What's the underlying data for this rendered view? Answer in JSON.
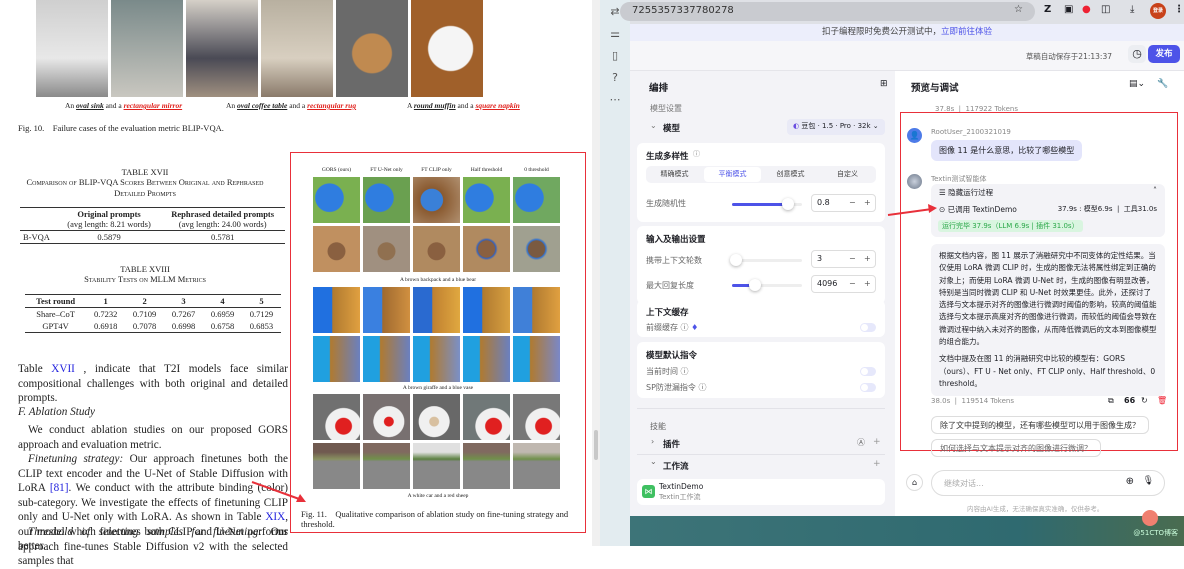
{
  "pdf": {
    "fig10_captions": [
      {
        "pre": "An ",
        "a": "oval sink",
        "mid": " and a ",
        "b": "rectangular mirror"
      },
      {
        "pre": "An ",
        "a": "oval coffee table",
        "mid": " and a ",
        "b": "rectangular rug"
      },
      {
        "pre": "A ",
        "a": "round muffin",
        "mid": " and a ",
        "b": "square napkin"
      }
    ],
    "fig10_caption": "Fig. 10.    Failure cases of the evaluation metric BLIP-VQA.",
    "table17": {
      "title": "TABLE XVII",
      "subtitle": "Comparison of BLIP-VQA Scores Between Original and Rephrased Detailed Prompts",
      "col1": "Original prompts",
      "col1_sub": "(avg length: 8.21 words)",
      "col2": "Rephrased detailed prompts",
      "col2_sub": "(avg length: 24.00 words)",
      "row_label": "B-VQA",
      "v1": "0.5879",
      "v2": "0.5781"
    },
    "table18": {
      "title": "TABLE XVIII",
      "subtitle": "Stability Tests on MLLM Metrics",
      "headers": [
        "Test round",
        "1",
        "2",
        "3",
        "4",
        "5"
      ],
      "rows": [
        [
          "Share–CoT",
          "0.7232",
          "0.7109",
          "0.7267",
          "0.6959",
          "0.7129"
        ],
        [
          "GPT4V",
          "0.6918",
          "0.7078",
          "0.6998",
          "0.6758",
          "0.6853"
        ]
      ]
    },
    "para1_pre": "Table ",
    "para1_link": "XVII",
    "para1_post": " , indicate that T2I models face similar compositional challenges with both original and detailed prompts.",
    "section": "F.  Ablation Study",
    "para2": "We conduct ablation studies on our proposed GORS approach and evaluation metric.",
    "para3_title": "Finetuning strategy:",
    "para3_a": " Our approach finetunes both the CLIP text encoder and the U-Net of Stable Diffusion with LoRA ",
    "para3_ref": "[81]",
    "para3_b": ". We conduct with the attribute binding (color) sub-category. We investigate the effects of finetuning CLIP only and U-Net only with LoRA. As shown in Table ",
    "para3_ref2": "XIX",
    "para3_c": ", our model which finetunes both CLIP and U-Net performs better.",
    "para4_title": "Threshold of selecting samples for finetuning:",
    "para4": " Our approach fine-tunes Stable Diffusion v2 with the selected samples that",
    "fig11": {
      "columns": [
        "GORS (ours)",
        "FT U-Net only",
        "FT CLIP only",
        "Half threshold",
        "0 threshold"
      ],
      "row_captions": [
        "A brown backpack and a blue bear",
        "A brown giraffe and a blue vase",
        "A white car and a red sheep"
      ],
      "caption": "Fig. 11.    Qualitative comparison of ablation study on fine-tuning strategy and threshold."
    }
  },
  "browser": {
    "url": "7255357337780278",
    "banner_text": "扣子编程限时免费公开测试中，",
    "banner_link": "立即前往体验",
    "autosave": "草稿自动保存于21:13:37",
    "publish": "发布",
    "avatar_text": "登录"
  },
  "editor": {
    "title": "编排",
    "model_settings": "模型设置",
    "model_label": "模型",
    "model_value": "豆包 · 1.5 · Pro · 32k",
    "diversity": {
      "title": "生成多样性",
      "modes": [
        "精确模式",
        "平衡模式",
        "创意模式",
        "自定义"
      ],
      "active": 1,
      "randomness_label": "生成随机性",
      "randomness_value": "0.8",
      "randomness_fraction": 0.8
    },
    "io": {
      "title": "输入及输出设置",
      "rounds_label": "携带上下文轮数",
      "rounds_value": "3",
      "max_label": "最大回复长度",
      "max_value": "4096"
    },
    "cache": {
      "title": "上下文缓存",
      "prefix_label": "前缀缓存"
    },
    "defaults": {
      "title": "模型默认指令",
      "time_label": "当前时间",
      "sp_label": "SP防泄漏指令"
    },
    "skills": "技能",
    "plugins": "插件",
    "workflow": "工作流",
    "workflow_item": {
      "name": "TextinDemo",
      "desc": "Textin工作流"
    }
  },
  "preview": {
    "title": "预览与调试",
    "prev_stats": "37.8s  |  117922 Tokens",
    "user_name": "RootUser_2100321019",
    "user_msg": "图像 11 是什么意思，比较了哪些模型",
    "bot_name": "Textin测试智能体",
    "process_toggle": "隐藏运行过程",
    "called": "已调用 TextinDemo",
    "called_stats": "37.9s : 模型6.9s  |  工具31.0s",
    "done": "运行完毕 37.9s（LLM 6.9s | 插件 31.0s）",
    "answer_p1": "根据文档内容，图 11 展示了消融研究中不同变体的定性结果。当仅使用 LoRA 微调 CLIP 时，生成的图像无法将属性绑定到正确的对象上；而使用 LoRA 微调 U-Net 时，生成的图像有明显改善，特别是当同时微调 CLIP 和 U-Net 时效果更佳。此外，还探讨了选择与文本提示对齐的图像进行微调时阈值的影响，较高的阈值能选择与文本提示高度对齐的图像进行微调，而较低的阈值会导致在微调过程中纳入未对齐的图像，从而降低微调后的文本到图像模型的组合能力。",
    "answer_p2": "文档中提及在图 11 的消融研究中比较的模型有：GORS（ours）、FT U - Net only、FT CLIP only、Half threshold、0 threshold。",
    "answer_stats": "38.0s  |  119514 Tokens",
    "suggestions": [
      "除了文中提到的模型，还有哪些模型可以用于图像生成？",
      "如何选择与文本提示对齐的图像进行微调？"
    ],
    "input_placeholder": "继续对话...",
    "disclaimer": "内容由AI生成，无法确保真实准确，仅供参考。",
    "watermark": "@51CTO博客"
  },
  "colors": {
    "accent": "#4d53e8",
    "annotation": "#e8303a",
    "success_bg": "#d9f5e0",
    "success_text": "#2ca84a"
  }
}
